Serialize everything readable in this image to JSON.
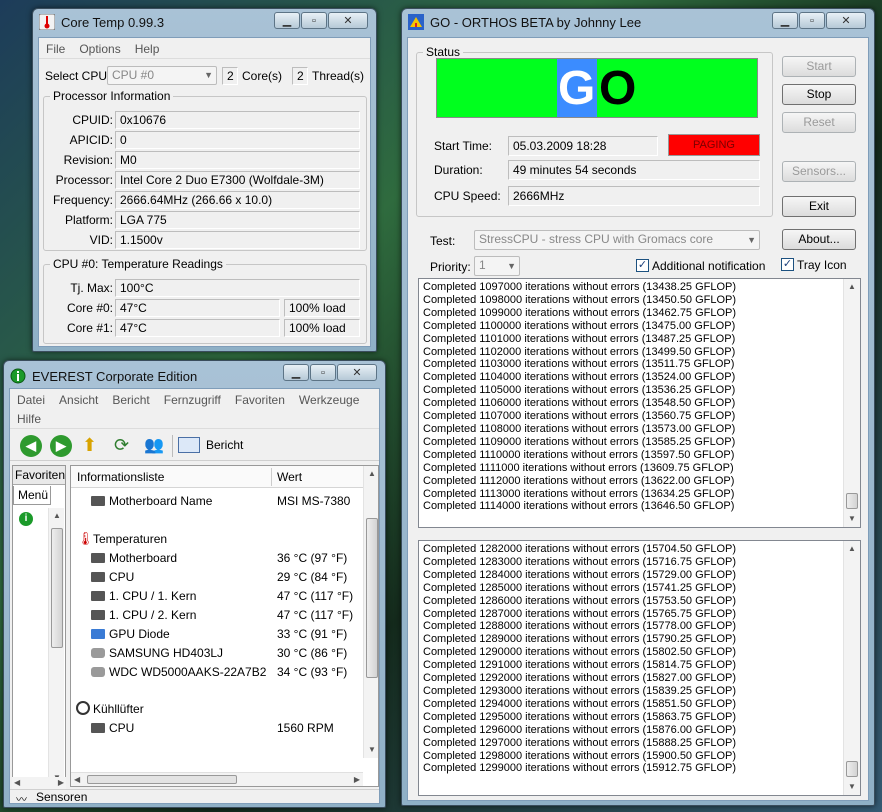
{
  "coretemp": {
    "title": "Core Temp 0.99.3",
    "menu": [
      "File",
      "Options",
      "Help"
    ],
    "select_cpu_label": "Select CPU:",
    "cpu_selected": "CPU #0",
    "cores_count": "2",
    "cores_label": "Core(s)",
    "threads_count": "2",
    "threads_label": "Thread(s)",
    "processor_info_title": "Processor Information",
    "fields": [
      {
        "label": "CPUID:",
        "value": "0x10676"
      },
      {
        "label": "APICID:",
        "value": "0"
      },
      {
        "label": "Revision:",
        "value": "M0"
      },
      {
        "label": "Processor:",
        "value": "Intel Core 2 Duo E7300 (Wolfdale-3M)"
      },
      {
        "label": "Frequency:",
        "value": "2666.64MHz (266.66 x 10.0)"
      },
      {
        "label": "Platform:",
        "value": "LGA 775"
      },
      {
        "label": "VID:",
        "value": "1.1500v"
      }
    ],
    "temp_title": "CPU #0: Temperature Readings",
    "tjmax_label": "Tj. Max:",
    "tjmax_value": "100°C",
    "cores": [
      {
        "label": "Core #0:",
        "temp": "47°C",
        "load": "100% load"
      },
      {
        "label": "Core #1:",
        "temp": "47°C",
        "load": "100% load"
      }
    ]
  },
  "orthos": {
    "title": "GO - ORTHOS BETA by Johnny Lee",
    "status_title": "Status",
    "go_g": "G",
    "go_o": "O",
    "start_time_label": "Start Time:",
    "start_time_value": "05.03.2009 18:28",
    "paging_label": "PAGING",
    "duration_label": "Duration:",
    "duration_value": "49 minutes 54 seconds",
    "cpu_speed_label": "CPU Speed:",
    "cpu_speed_value": "2666MHz",
    "test_label": "Test:",
    "test_value": "StressCPU - stress CPU with Gromacs core",
    "priority_label": "Priority:",
    "priority_value": "1",
    "additional_notification": "Additional notification",
    "tray_icon": "Tray Icon",
    "buttons": {
      "start": "Start",
      "stop": "Stop",
      "reset": "Reset",
      "sensors": "Sensors...",
      "exit": "Exit",
      "about": "About..."
    },
    "log1": [
      "Completed 1097000 iterations without errors (13438.25 GFLOP)",
      "Completed 1098000 iterations without errors (13450.50 GFLOP)",
      "Completed 1099000 iterations without errors (13462.75 GFLOP)",
      "Completed 1100000 iterations without errors (13475.00 GFLOP)",
      "Completed 1101000 iterations without errors (13487.25 GFLOP)",
      "Completed 1102000 iterations without errors (13499.50 GFLOP)",
      "Completed 1103000 iterations without errors (13511.75 GFLOP)",
      "Completed 1104000 iterations without errors (13524.00 GFLOP)",
      "Completed 1105000 iterations without errors (13536.25 GFLOP)",
      "Completed 1106000 iterations without errors (13548.50 GFLOP)",
      "Completed 1107000 iterations without errors (13560.75 GFLOP)",
      "Completed 1108000 iterations without errors (13573.00 GFLOP)",
      "Completed 1109000 iterations without errors (13585.25 GFLOP)",
      "Completed 1110000 iterations without errors (13597.50 GFLOP)",
      "Completed 1111000 iterations without errors (13609.75 GFLOP)",
      "Completed 1112000 iterations without errors (13622.00 GFLOP)",
      "Completed 1113000 iterations without errors (13634.25 GFLOP)",
      "Completed 1114000 iterations without errors (13646.50 GFLOP)"
    ],
    "log2": [
      "Completed 1282000 iterations without errors (15704.50 GFLOP)",
      "Completed 1283000 iterations without errors (15716.75 GFLOP)",
      "Completed 1284000 iterations without errors (15729.00 GFLOP)",
      "Completed 1285000 iterations without errors (15741.25 GFLOP)",
      "Completed 1286000 iterations without errors (15753.50 GFLOP)",
      "Completed 1287000 iterations without errors (15765.75 GFLOP)",
      "Completed 1288000 iterations without errors (15778.00 GFLOP)",
      "Completed 1289000 iterations without errors (15790.25 GFLOP)",
      "Completed 1290000 iterations without errors (15802.50 GFLOP)",
      "Completed 1291000 iterations without errors (15814.75 GFLOP)",
      "Completed 1292000 iterations without errors (15827.00 GFLOP)",
      "Completed 1293000 iterations without errors (15839.25 GFLOP)",
      "Completed 1294000 iterations without errors (15851.50 GFLOP)",
      "Completed 1295000 iterations without errors (15863.75 GFLOP)",
      "Completed 1296000 iterations without errors (15876.00 GFLOP)",
      "Completed 1297000 iterations without errors (15888.25 GFLOP)",
      "Completed 1298000 iterations without errors (15900.50 GFLOP)",
      "Completed 1299000 iterations without errors (15912.75 GFLOP)"
    ]
  },
  "everest": {
    "title": "EVEREST Corporate Edition",
    "menu": [
      "Datei",
      "Ansicht",
      "Bericht",
      "Fernzugriff",
      "Favoriten",
      "Werkzeuge"
    ],
    "menu2": "Hilfe",
    "report_label": "Bericht",
    "tab_favoriten": "Favoriten",
    "tab_menu": "Menü",
    "col_info": "Informationsliste",
    "col_value": "Wert",
    "mb_name_label": "Motherboard Name",
    "mb_name_value": "MSI MS-7380",
    "temp_section": "Temperaturen",
    "temps": [
      {
        "name": "Motherboard",
        "value": "36 °C  (97 °F)"
      },
      {
        "name": "CPU",
        "value": "29 °C  (84 °F)"
      },
      {
        "name": "1. CPU / 1. Kern",
        "value": "47 °C  (117 °F)"
      },
      {
        "name": "1. CPU / 2. Kern",
        "value": "47 °C  (117 °F)"
      },
      {
        "name": "GPU Diode",
        "value": "33 °C  (91 °F)"
      },
      {
        "name": "SAMSUNG HD403LJ",
        "value": "30 °C  (86 °F)"
      },
      {
        "name": "WDC WD5000AAKS-22A7B2",
        "value": "34 °C  (93 °F)"
      }
    ],
    "fan_section": "Kühllüfter",
    "fan_name": "CPU",
    "fan_value": "1560 RPM",
    "status_text": "Sensoren"
  },
  "colors": {
    "go_green": "#00ff1e",
    "go_blue": "#3b8cff",
    "paging_red": "#ff0000"
  }
}
